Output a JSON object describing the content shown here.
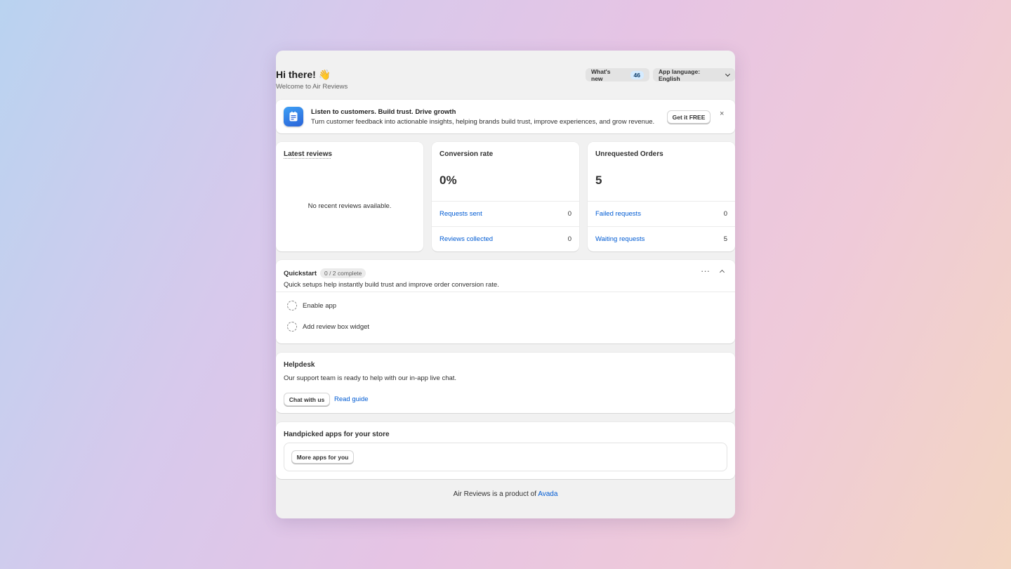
{
  "header": {
    "title": "Hi there! 👋",
    "subtitle": "Welcome to Air Reviews",
    "whats_new_label": "What's new",
    "whats_new_count": "46",
    "language_label": "App language: English"
  },
  "banner": {
    "title": "Listen to customers. Build trust. Drive growth",
    "text": "Turn customer feedback into actionable insights, helping brands build trust, improve experiences, and grow revenue.",
    "cta_label": "Get it FREE",
    "close_label": "×"
  },
  "latest_reviews": {
    "title": "Latest reviews",
    "empty_message": "No recent reviews available."
  },
  "conversion": {
    "title": "Conversion rate",
    "value": "0%",
    "rows": [
      {
        "label": "Requests sent",
        "value": "0"
      },
      {
        "label": "Reviews collected",
        "value": "0"
      }
    ]
  },
  "unrequested": {
    "title": "Unrequested Orders",
    "value": "5",
    "rows": [
      {
        "label": "Failed requests",
        "value": "0"
      },
      {
        "label": "Waiting requests",
        "value": "5"
      }
    ]
  },
  "quickstart": {
    "title": "Quickstart",
    "badge": "0 / 2 complete",
    "description": "Quick setups help instantly build trust and improve order conversion rate.",
    "more_label": "···",
    "tasks": [
      {
        "label": "Enable app"
      },
      {
        "label": "Add review box widget"
      }
    ]
  },
  "helpdesk": {
    "title": "Helpdesk",
    "description": "Our support team is ready to help with our in-app live chat.",
    "chat_label": "Chat with us",
    "guide_label": "Read guide"
  },
  "apps": {
    "title": "Handpicked apps for your store",
    "more_label": "More apps for you"
  },
  "footer": {
    "text": "Air Reviews is a product of",
    "link": "Avada"
  },
  "colors": {
    "link": "#005bd3",
    "window_bg": "#f1f1f1",
    "badge_bg": "#d5ebff"
  },
  "icons": [
    "chevron-down-icon",
    "close-icon",
    "more-horizontal-icon",
    "chevron-up-icon",
    "app-logo-icon",
    "dashed-circle-icon"
  ]
}
